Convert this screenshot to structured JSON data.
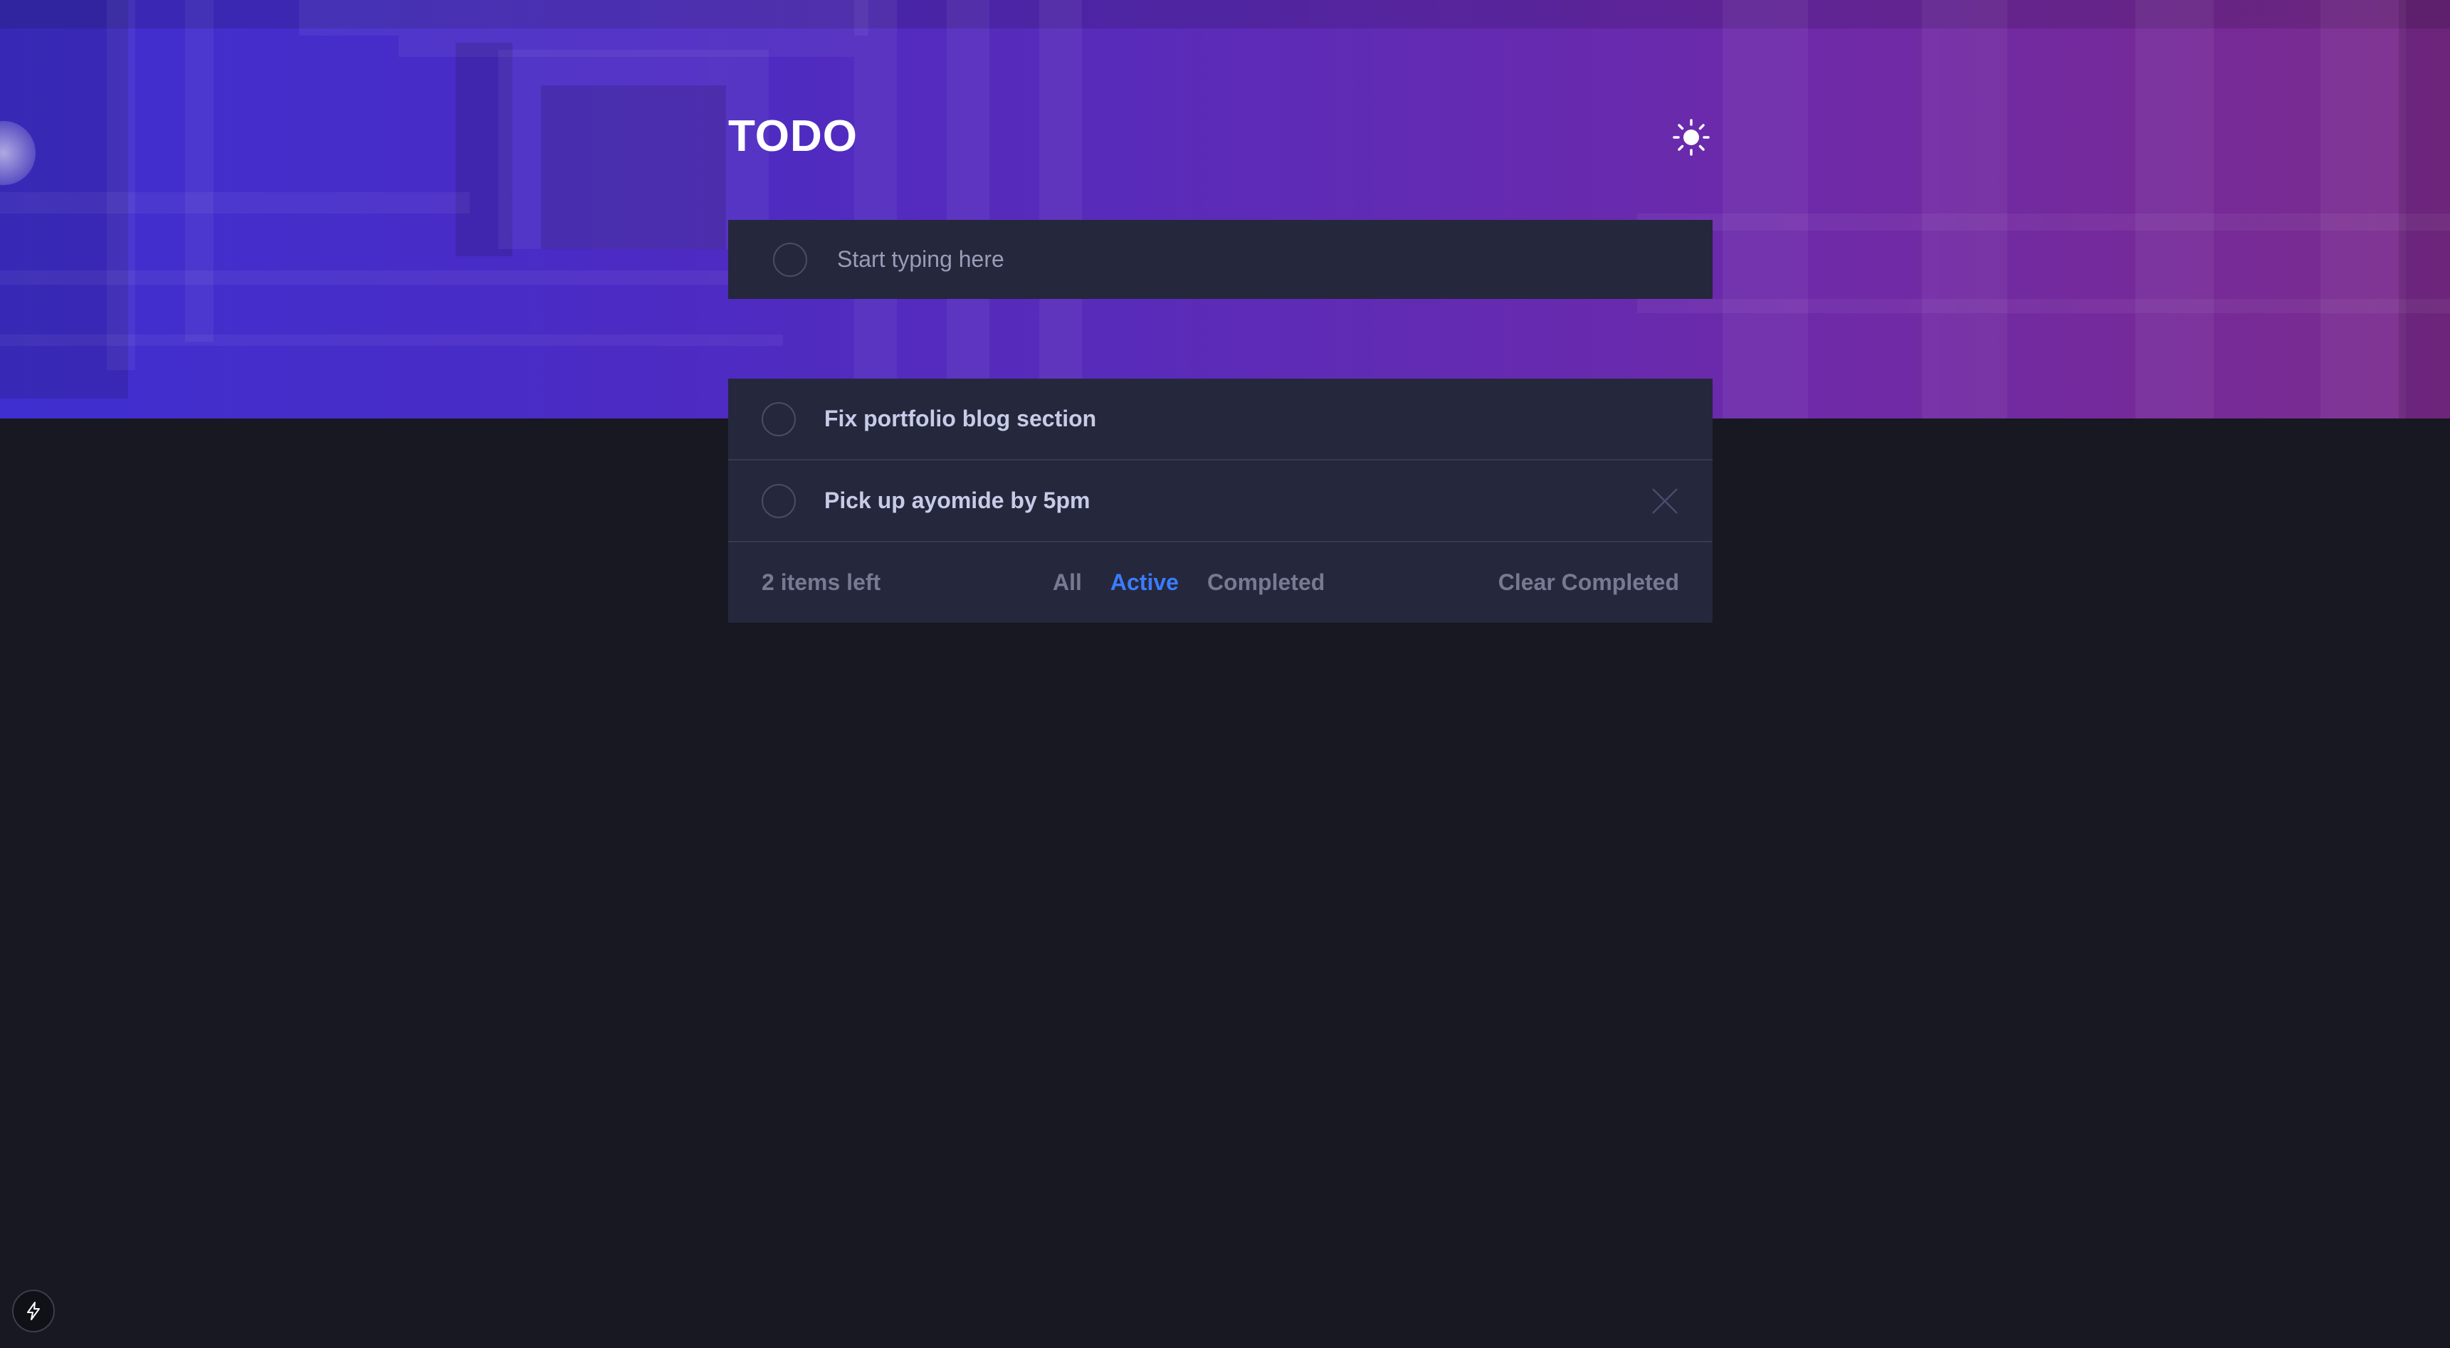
{
  "header": {
    "title": "TODO",
    "theme_toggle_icon": "sun-icon"
  },
  "new_todo": {
    "placeholder": "Start typing here",
    "value": ""
  },
  "todos": [
    {
      "label": "Fix portfolio blog section",
      "completed": false
    },
    {
      "label": "Pick up ayomide by 5pm",
      "completed": false
    }
  ],
  "footer": {
    "items_left": "2 items left",
    "filters": {
      "all": "All",
      "active": "Active",
      "completed": "Completed"
    },
    "selected_filter": "Active",
    "clear_completed": "Clear Completed"
  },
  "colors": {
    "accent": "#3a7cfd",
    "background": "#171821",
    "card": "#25273c",
    "hero_gradient_start": "#3f2fd0",
    "hero_gradient_end": "#7b2b8c"
  },
  "dev_badge_icon": "lightning-icon"
}
